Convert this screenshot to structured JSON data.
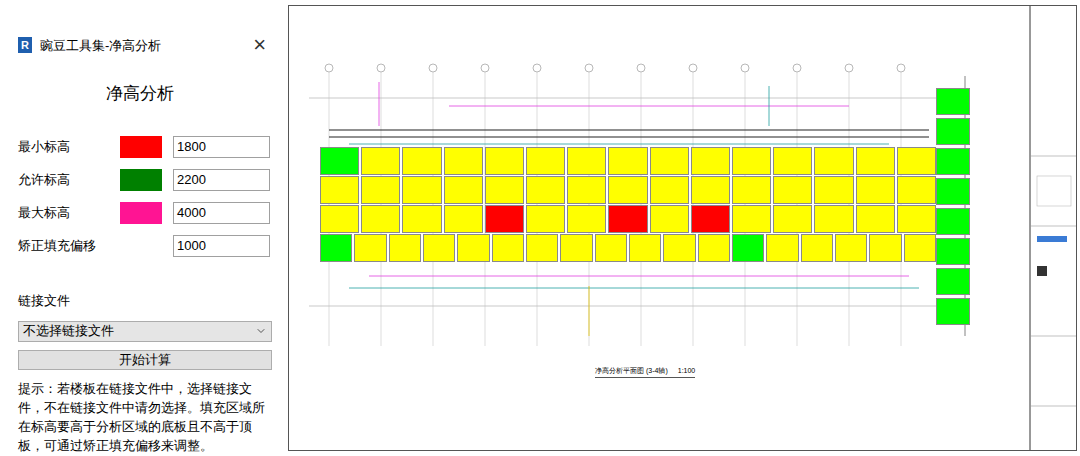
{
  "window": {
    "app_icon": "R",
    "title": "豌豆工具集-净高分析",
    "close": "×"
  },
  "heading": "净高分析",
  "settings": [
    {
      "label": "最小标高",
      "value": "1800",
      "color": "#ff0000"
    },
    {
      "label": "允许标高",
      "value": "2200",
      "color": "#008000"
    },
    {
      "label": "最大标高",
      "value": "4000",
      "color": "#ff1493"
    },
    {
      "label": "矫正填充偏移",
      "value": "1000"
    }
  ],
  "link_file": {
    "label": "链接文件",
    "selected": "不选择链接文件"
  },
  "start_button": "开始计算",
  "hint": "提示：若楼板在链接文件中，选择链接文件，不在链接文件中请勿选择。填充区域所在标高要高于分析区域的底板且不高于顶板，可通过矫正填充偏移来调整。",
  "drawing": {
    "rows": [
      {
        "cells": [
          "#00ff00",
          "#ffff00",
          "#ffff00",
          "#ffff00",
          "#ffff00",
          "#ffff00",
          "#ffff00",
          "#ffff00",
          "#ffff00",
          "#ffff00",
          "#ffff00",
          "#ffff00",
          "#ffff00",
          "#ffff00",
          "#ffff00"
        ]
      },
      {
        "cells": [
          "#ffff00",
          "#ffff00",
          "#ffff00",
          "#ffff00",
          "#ffff00",
          "#ffff00",
          "#ffff00",
          "#ffff00",
          "#ffff00",
          "#ffff00",
          "#ffff00",
          "#ffff00",
          "#ffff00",
          "#ffff00",
          "#ffff00"
        ]
      },
      {
        "cells": [
          "#ffff00",
          "#ffff00",
          "#ffff00",
          "#ffff00",
          "#ff0000",
          "#ffff00",
          "#ffff00",
          "#ff0000",
          "#ffff00",
          "#ff0000",
          "#ffff00",
          "#ffff00",
          "#ffff00",
          "#ffff00",
          "#ffff00"
        ]
      },
      {
        "cells": [
          "#00ff00",
          "#ffff00",
          "#ffff00",
          "#ffff00",
          "#ffff00",
          "#ffff00",
          "#ffff00",
          "#ffff00",
          "#ffff00",
          "#ffff00",
          "#ffff00",
          "#ffff00",
          "#00ff00",
          "#ffff00",
          "#ffff00",
          "#ffff00",
          "#ffff00",
          "#ffff00"
        ]
      }
    ],
    "side_column": [
      "#00ff00",
      "#00ff00",
      "#00ff00",
      "#00ff00",
      "#00ff00",
      "#00ff00",
      "#00ff00",
      "#00ff00"
    ],
    "caption": "净高分析平面图 (3-4轴)",
    "scale": "1:100"
  }
}
